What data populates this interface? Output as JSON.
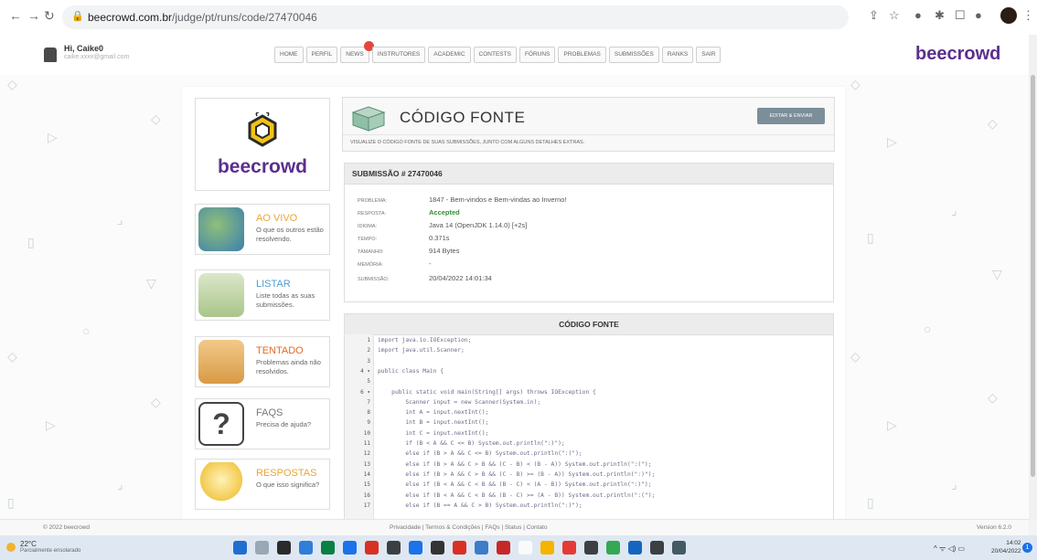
{
  "browser": {
    "url_host": "beecrowd.com.br",
    "url_path": "/judge/pt/runs/code/27470046"
  },
  "user": {
    "greeting": "Hi, Caike0",
    "email": "caike.xxxx@gmail.com"
  },
  "menu": [
    {
      "label": "HOME"
    },
    {
      "label": "PERFIL"
    },
    {
      "label": "NEWS",
      "badge": true
    },
    {
      "label": "INSTRUTORES"
    },
    {
      "label": "ACADEMIC"
    },
    {
      "label": "CONTESTS"
    },
    {
      "label": "FÓRUNS"
    },
    {
      "label": "PROBLEMAS"
    },
    {
      "label": "SUBMISSÕES"
    },
    {
      "label": "RANKS"
    },
    {
      "label": "SAIR"
    }
  ],
  "brand": "beecrowd",
  "sidebar": [
    {
      "title": "AO VIVO",
      "desc": "O que os outros estão resolvendo.",
      "color": "#e8a63a",
      "icon": "globe-icon"
    },
    {
      "title": "LISTAR",
      "desc": "Liste todas as suas submissões.",
      "color": "#4f9bd5",
      "icon": "list-icon"
    },
    {
      "title": "TENTADO",
      "desc": "Problemas ainda não resolvidos.",
      "color": "#e26b28",
      "icon": "box-icon"
    },
    {
      "title": "FAQS",
      "desc": "Precisa de ajuda?",
      "color": "#777777",
      "icon": "question-icon"
    },
    {
      "title": "RESPOSTAS",
      "desc": "O que isso significa?",
      "color": "#e8a63a",
      "icon": "lightbulb-icon"
    }
  ],
  "header": {
    "title": "CÓDIGO FONTE",
    "button": "EDITAR & ENVIAR",
    "description": "VISUALIZE O CÓDIGO FONTE DE SUAS SUBMISSÕES, JUNTO COM ALGUNS DETALHES EXTRAS."
  },
  "submission": {
    "heading": "SUBMISSÃO # 27470046",
    "fields": [
      {
        "key": "PROBLEMA:",
        "value": "1847 - Bem-vindos e Bem-vindas ao Inverno!"
      },
      {
        "key": "RESPOSTA:",
        "value": "Accepted"
      },
      {
        "key": "IDIOMA:",
        "value": "Java 14 (OpenJDK 1.14.0) [+2s]"
      },
      {
        "key": "TEMPO:",
        "value": "0.371s"
      },
      {
        "key": "TAMANHO:",
        "value": "914 Bytes"
      },
      {
        "key": "MEMÓRIA:",
        "value": "-"
      },
      {
        "key": "SUBMISSÃO:",
        "value": "20/04/2022 14:01:34"
      }
    ]
  },
  "code": {
    "heading": "CÓDIGO FONTE",
    "lines": [
      {
        "n": "1",
        "text": "import java.io.IOException;"
      },
      {
        "n": "2",
        "text": "import java.util.Scanner;"
      },
      {
        "n": "3",
        "text": ""
      },
      {
        "n": "4 ▾",
        "text": "public class Main {"
      },
      {
        "n": "5",
        "text": ""
      },
      {
        "n": "6 ▾",
        "text": "    public static void main(String[] args) throws IOException {"
      },
      {
        "n": "7",
        "text": "        Scanner input = new Scanner(System.in);"
      },
      {
        "n": "8",
        "text": "        int A = input.nextInt();"
      },
      {
        "n": "9",
        "text": "        int B = input.nextInt();"
      },
      {
        "n": "10",
        "text": "        int C = input.nextInt();"
      },
      {
        "n": "11",
        "text": "        if (B < A && C <= B) System.out.println(\":)\");"
      },
      {
        "n": "12",
        "text": "        else if (B > A && C <= B) System.out.println(\":(\");"
      },
      {
        "n": "13",
        "text": "        else if (B > A && C > B && (C - B) < (B - A)) System.out.println(\":(\");"
      },
      {
        "n": "14",
        "text": "        else if (B > A && C > B && (C - B) >= (B - A)) System.out.println(\":)\");"
      },
      {
        "n": "15",
        "text": "        else if (B < A && C < B && (B - C) < (A - B)) System.out.println(\":)\");"
      },
      {
        "n": "16",
        "text": "        else if (B < A && C < B && (B - C) >= (A - B)) System.out.println(\":(\");"
      },
      {
        "n": "17",
        "text": "        else if (B == A && C > B) System.out.println(\":)\");"
      }
    ]
  },
  "footer": {
    "copyright": "© 2022 beecrowd",
    "links": "Privacidade  |  Termos & Condições  |  FAQs  |  Status  |  Contato",
    "version": "Version 6.2.0"
  },
  "taskbar": {
    "temp": "22°C",
    "weather": "Parcialmente ensolarado",
    "time": "14:02",
    "date": "20/04/2022",
    "notifications": "1",
    "app_colors": [
      "#1f6fd1",
      "#9aa7b4",
      "#2b2b2b",
      "#2f7ed8",
      "#0b8043",
      "#1a73e8",
      "#d93025",
      "#3c4043",
      "#1a73e8",
      "#333333",
      "#d93025",
      "#3c7cc9",
      "#c62828",
      "#fafafa",
      "#f4b400",
      "#e53935",
      "#3c4043",
      "#34a853",
      "#1565c0",
      "#3c4043",
      "#455a64"
    ]
  }
}
